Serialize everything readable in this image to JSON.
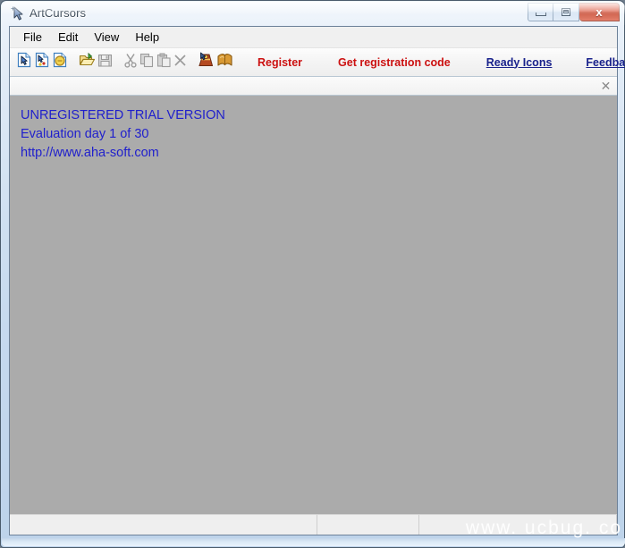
{
  "window": {
    "title": "ArtCursors",
    "app_icon": "cursor-arrow-icon",
    "caption": {
      "minimize_label": "Minimize",
      "maximize_label": "Maximize",
      "close_label": "x"
    }
  },
  "menubar": {
    "items": [
      {
        "label": "File",
        "name": "menu-file"
      },
      {
        "label": "Edit",
        "name": "menu-edit"
      },
      {
        "label": "View",
        "name": "menu-view"
      },
      {
        "label": "Help",
        "name": "menu-help"
      }
    ]
  },
  "toolbar": {
    "buttons": [
      {
        "icon": "new-cursor-icon",
        "enabled": true
      },
      {
        "icon": "new-animated-cursor-icon",
        "enabled": true
      },
      {
        "icon": "new-cursor-library-icon",
        "enabled": true
      },
      {
        "icon": "open-folder-icon",
        "enabled": true
      },
      {
        "icon": "save-icon",
        "enabled": false
      },
      {
        "icon": "cut-icon",
        "enabled": false
      },
      {
        "icon": "copy-icon",
        "enabled": false
      },
      {
        "icon": "paste-icon",
        "enabled": false
      },
      {
        "icon": "delete-x-icon",
        "enabled": false
      },
      {
        "icon": "cursor-library-icon",
        "enabled": true
      },
      {
        "icon": "book-icon",
        "enabled": true
      }
    ],
    "links": {
      "register": "Register",
      "get_code": "Get registration code",
      "ready_icons": "Ready Icons",
      "feedback": "Feedback"
    }
  },
  "nagbar": {
    "close_label": "✕"
  },
  "workspace": {
    "trial_lines": [
      "UNREGISTERED TRIAL VERSION",
      "Evaluation day 1 of 30",
      "http://www.aha-soft.com"
    ],
    "background_color": "#ababab",
    "text_color": "#2020cc"
  },
  "statusbar": {
    "panes": [
      "",
      "",
      ""
    ],
    "watermark": "www. ucbug. co"
  },
  "colors": {
    "register_red": "#cc1111",
    "link_blue": "#19228c",
    "title_glass": "#cfe0f1"
  }
}
